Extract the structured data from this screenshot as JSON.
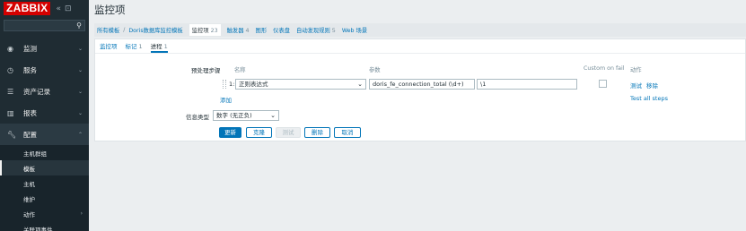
{
  "app": {
    "logo": "ZABBIX",
    "collapse_icon": "«",
    "kiosk_icon": "⊡"
  },
  "sidebar": {
    "items": [
      {
        "label": "监测",
        "icon": "eye-icon"
      },
      {
        "label": "服务",
        "icon": "clock-icon"
      },
      {
        "label": "资产记录",
        "icon": "list-icon"
      },
      {
        "label": "报表",
        "icon": "chart-icon"
      },
      {
        "label": "配置",
        "icon": "wrench-icon"
      }
    ],
    "submenu": [
      "主机群组",
      "模板",
      "主机",
      "维护",
      "动作",
      "关联项事件"
    ]
  },
  "page": {
    "title": "监控项"
  },
  "nav": {
    "all_templates": "所有模板",
    "separator": "/",
    "template_name": "Doris数据库监控模板",
    "links": [
      {
        "label": "监控项",
        "count": "23"
      },
      {
        "label": "触发器",
        "count": "4"
      },
      {
        "label": "图形",
        "count": ""
      },
      {
        "label": "仪表盘",
        "count": ""
      },
      {
        "label": "自动发现规则",
        "count": "5"
      },
      {
        "label": "Web 场景",
        "count": ""
      }
    ]
  },
  "tabs": [
    {
      "label": "监控项",
      "count": ""
    },
    {
      "label": "标记",
      "count": "1"
    },
    {
      "label": "进程",
      "count": "1"
    }
  ],
  "preprocessing": {
    "section_label": "预处理步骤",
    "col_name": "名称",
    "col_params": "参数",
    "col_custom_on_fail": "Custom on fail",
    "col_actions": "动作",
    "step_number": "1:",
    "step_type": "正则表达式",
    "param1": "doris_fe_connection_total (\\d+)",
    "param2": "\\1",
    "action_test": "测试",
    "action_remove": "移除",
    "add_link": "添加",
    "test_all": "Test all steps"
  },
  "info_type": {
    "label": "信息类型",
    "value": "数字 (无正负)"
  },
  "buttons": {
    "update": "更新",
    "clone": "克隆",
    "test": "测试",
    "delete": "删除",
    "cancel": "取消"
  }
}
